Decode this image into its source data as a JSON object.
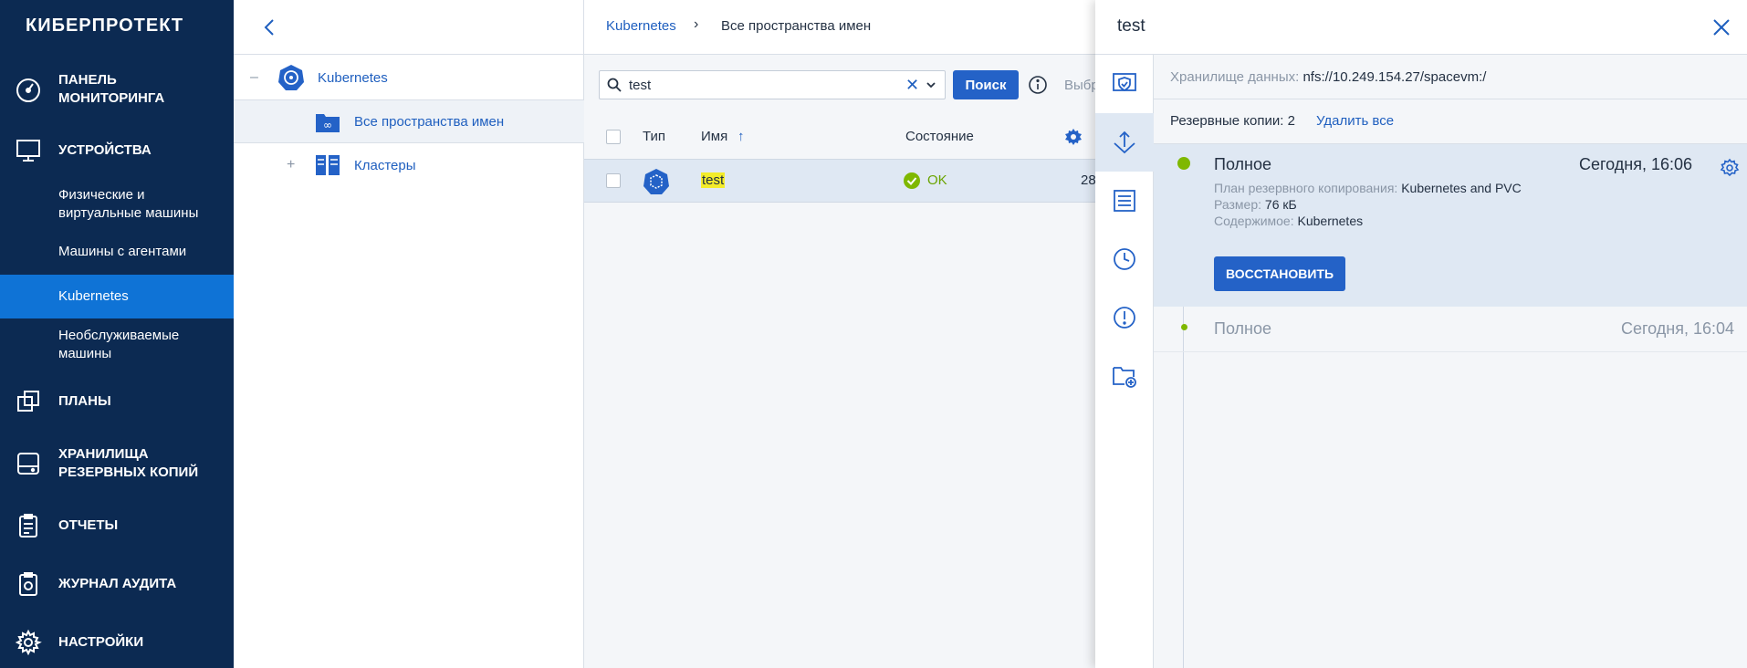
{
  "sidebar": {
    "logo": "КИБЕРПРОТЕКТ",
    "items": [
      {
        "label": "ПАНЕЛЬ\nМОНИТОРИНГА",
        "icon": "dashboard-icon"
      },
      {
        "label": "УСТРОЙСТВА",
        "icon": "monitor-icon"
      },
      {
        "label": "ПЛАНЫ",
        "icon": "plans-icon"
      },
      {
        "label": "ХРАНИЛИЩА\nРЕЗЕРВНЫХ КОПИЙ",
        "icon": "storage-icon"
      },
      {
        "label": "ОТЧЕТЫ",
        "icon": "reports-icon"
      },
      {
        "label": "ЖУРНАЛ АУДИТА",
        "icon": "audit-icon"
      },
      {
        "label": "НАСТРОЙКИ",
        "icon": "gear-icon"
      }
    ],
    "subitems": [
      {
        "label": "Физические и\nвиртуальные машины"
      },
      {
        "label": "Машины с агентами"
      },
      {
        "label": "Kubernetes",
        "active": true
      },
      {
        "label": "Необслуживаемые\nмашины"
      }
    ],
    "bg_color": "#0c2a52",
    "active_color": "#0f73d6"
  },
  "tree": {
    "items": [
      {
        "label": "Kubernetes",
        "toggle": "–"
      },
      {
        "label": "Все пространства имен"
      },
      {
        "label": "Кластеры",
        "toggle": "+"
      }
    ]
  },
  "breadcrumb": {
    "root": "Kubernetes",
    "separator": "›",
    "current": "Все пространства имен"
  },
  "search": {
    "value": "test",
    "clear": "✕",
    "button_label": "Поиск",
    "select_text": "Выбр"
  },
  "table": {
    "headers": {
      "type": "Тип",
      "name": "Имя",
      "sort_arrow": "↑",
      "state": "Состояние"
    },
    "row": {
      "name": "test",
      "status": "OK",
      "extra": "28"
    }
  },
  "details": {
    "title": "test",
    "storage_label": "Хранилище данных:",
    "storage_value": "nfs://10.249.154.27/spacevm:/",
    "backups_label": "Резервные копии: 2",
    "delete_all": "Удалить все",
    "backups": [
      {
        "type": "Полное",
        "time": "Сегодня, 16:06",
        "plan_label": "План резервного копирования:",
        "plan_value": "Kubernetes and PVC",
        "size_label": "Размер:",
        "size_value": "76 кБ",
        "content_label": "Содержимое:",
        "content_value": "Kubernetes",
        "restore_label": "ВОССТАНОВИТЬ"
      },
      {
        "type": "Полное",
        "time": "Сегодня, 16:04"
      }
    ],
    "accent_color": "#2462c7",
    "ok_color": "#7fb800"
  }
}
